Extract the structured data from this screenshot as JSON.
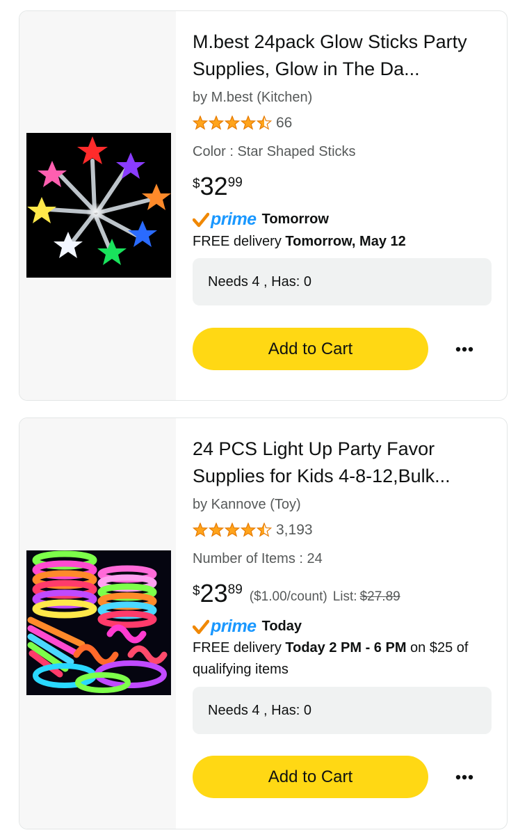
{
  "products": [
    {
      "title": "M.best 24pack Glow Sticks Party Supplies, Glow in The Da...",
      "brand": "by M.best (Kitchen)",
      "rating_value": 4.5,
      "rating_count": "66",
      "variant": "Color : Star Shaped Sticks",
      "price": {
        "currency": "$",
        "whole": "32",
        "fraction": "99"
      },
      "prime_label": "prime",
      "prime_when": "Tomorrow",
      "delivery": {
        "prefix": "FREE delivery ",
        "bold": "Tomorrow, May 12",
        "suffix": ""
      },
      "needs": "Needs 4 , Has: 0",
      "add_to_cart": "Add to Cart",
      "more_icon": "more-horizontal-icon"
    },
    {
      "title": "24 PCS Light Up Party Favor Supplies for Kids 4-8-12,Bulk...",
      "brand": "by Kannove (Toy)",
      "rating_value": 4.5,
      "rating_count": "3,193",
      "variant": "Number of Items : 24",
      "price": {
        "currency": "$",
        "whole": "23",
        "fraction": "89",
        "unit_price": "($1.00/count)",
        "list_label": "List:",
        "list_price": "$27.89"
      },
      "prime_label": "prime",
      "prime_when": "Today",
      "delivery": {
        "prefix": "FREE delivery ",
        "bold": "Today 2 PM - 6 PM",
        "suffix": " on $25 of qualifying items"
      },
      "needs": "Needs 4 , Has: 0",
      "add_to_cart": "Add to Cart",
      "more_icon": "more-horizontal-icon"
    }
  ],
  "colors": {
    "cart_button": "#ffd814",
    "star": "#ffa41c",
    "prime_blue": "#1a98ff",
    "prime_check": "#f08804",
    "secondary_text": "#565959"
  }
}
